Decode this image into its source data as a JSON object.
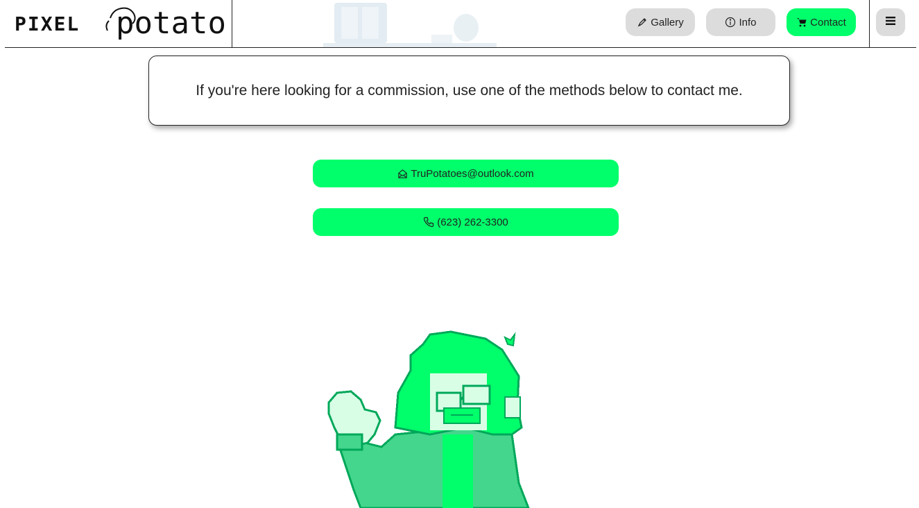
{
  "header": {
    "logo": {
      "text_left": "PIXEL",
      "text_right": "potato"
    },
    "nav": {
      "gallery_label": "Gallery",
      "info_label": "Info",
      "contact_label": "Contact"
    },
    "menu_icon": "hamburger-icon"
  },
  "main": {
    "intro_text": "If you're here looking for a commission, use one of the methods below to contact me.",
    "contacts": {
      "email": "TruPotatoes@outlook.com",
      "phone": "(623) 262-3300"
    }
  },
  "icons": {
    "gallery": "pen-icon",
    "info": "info-circle-icon",
    "contact": "cart-icon",
    "email": "envelope-open-icon",
    "phone": "phone-icon"
  },
  "colors": {
    "accent": "#00ff6a",
    "button_gray": "#dcdcdc",
    "mascot_bright": "#00ff6a",
    "mascot_mid": "#44d68c",
    "mascot_light": "#d8ffe6"
  }
}
